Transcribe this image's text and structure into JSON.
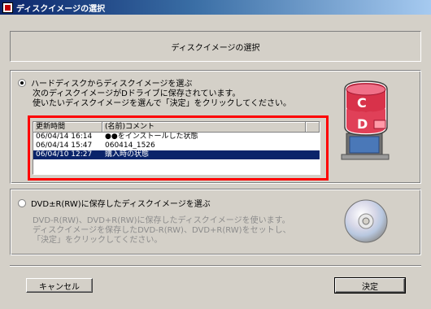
{
  "window": {
    "title": "ディスクイメージの選択"
  },
  "header": {
    "title": "ディスクイメージの選択"
  },
  "option_hdd": {
    "label": "ハードディスクからディスクイメージを選ぶ",
    "desc_line1": "次のディスクイメージがDドライブに保存されています。",
    "desc_line2": "使いたいディスクイメージを選んで「決定」をクリックしてください。"
  },
  "image_list": {
    "columns": [
      "更新時間",
      "(名前)コメント"
    ],
    "rows": [
      {
        "time": "06/04/14 16:14",
        "comment": "●●をインストールした状態"
      },
      {
        "time": "06/04/14 15:47",
        "comment": "060414_1526"
      },
      {
        "time": "06/04/10 12:27",
        "comment": "購入時の状態"
      }
    ],
    "selected_index": 2
  },
  "hdd_icon": {
    "letters": [
      "C",
      "D"
    ]
  },
  "option_dvd": {
    "label": "DVD±R(RW)に保存したディスクイメージを選ぶ",
    "desc_line1": "DVD-R(RW)、DVD+R(RW)に保存したディスクイメージを使います。",
    "desc_line2": "ディスクイメージを保存したDVD-R(RW)、DVD+R(RW)をセットし、",
    "desc_line3": "「決定」をクリックしてください。"
  },
  "buttons": {
    "cancel": "キャンセル",
    "ok": "決定"
  }
}
